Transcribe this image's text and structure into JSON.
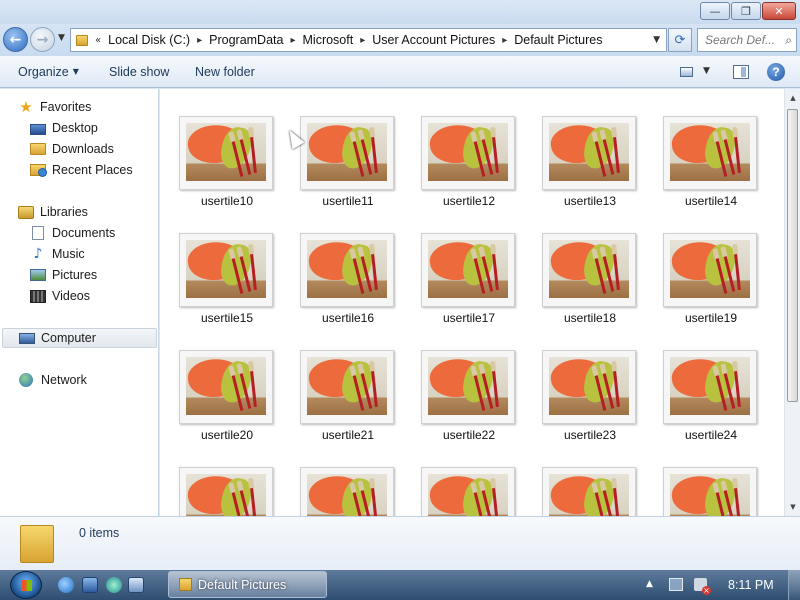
{
  "window": {
    "minimize_glyph": "—",
    "maximize_glyph": "❐",
    "close_glyph": "✕"
  },
  "address": {
    "back_glyph": "←",
    "forward_glyph": "→",
    "overflow": "«",
    "separator": "▸",
    "crumbs": [
      "Local Disk (C:)",
      "ProgramData",
      "Microsoft",
      "User Account Pictures",
      "Default Pictures"
    ],
    "refresh_glyph": "⟳",
    "search_placeholder": "Search Def...",
    "search_icon": "⌕"
  },
  "toolbar": {
    "organize": "Organize",
    "slideshow": "Slide show",
    "newfolder": "New folder",
    "help": "?"
  },
  "nav": {
    "favorites": "Favorites",
    "desktop": "Desktop",
    "downloads": "Downloads",
    "recent": "Recent Places",
    "libraries": "Libraries",
    "documents": "Documents",
    "music": "Music",
    "pictures": "Pictures",
    "videos": "Videos",
    "computer": "Computer",
    "network": "Network",
    "star_glyph": "★",
    "music_glyph": "♪"
  },
  "files": [
    "usertile10",
    "usertile11",
    "usertile12",
    "usertile13",
    "usertile14",
    "usertile15",
    "usertile16",
    "usertile17",
    "usertile18",
    "usertile19",
    "usertile20",
    "usertile21",
    "usertile22",
    "usertile23",
    "usertile24"
  ],
  "details": {
    "items": "0 items"
  },
  "taskbar": {
    "window_button": "Default Pictures",
    "clock": "8:11 PM"
  },
  "colors": {
    "accent": "#2d6bc2",
    "paint_orange": "#ec6a3c",
    "paint_green": "#b8c23f",
    "brush_red": "#b51f24"
  }
}
